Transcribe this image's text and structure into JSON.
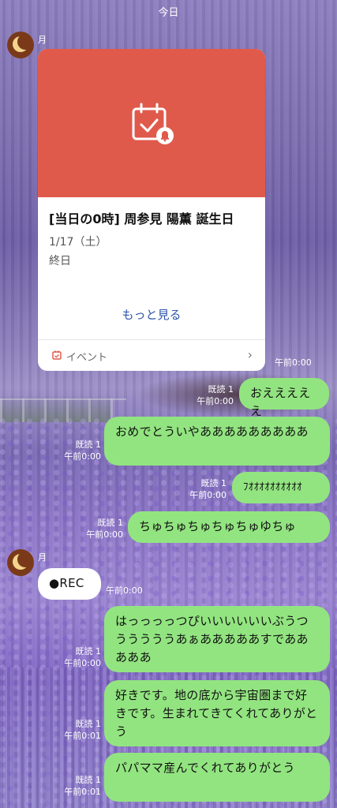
{
  "header": {
    "date_label": "今日"
  },
  "sender": {
    "name": "月"
  },
  "event_card": {
    "title": "[当日の0時] 周参見 陽薫 誕生日",
    "date": "1/17（土）",
    "all_day": "終日",
    "more_link": "もっと見る",
    "footer_label": "イベント",
    "colors": {
      "header": "#e05a4c",
      "link": "#2e56a8"
    }
  },
  "messages": [
    {
      "id": "m1",
      "text": "おえええええ",
      "read": "既読 1",
      "time": "午前0:00"
    },
    {
      "id": "m2",
      "text": "おめでとういやあああああああああ",
      "read": "既読 1",
      "time": "午前0:00"
    },
    {
      "id": "m3",
      "text": "ﾌｵｵｵｵｵｵｵｵｵｵ",
      "read": "既読 1",
      "time": "午前0:00"
    },
    {
      "id": "m4",
      "text": "ちゅちゅちゅちゅちゅゆちゅ",
      "read": "既読 1",
      "time": "午前0:00"
    },
    {
      "id": "m5",
      "text": "はっっっっつぴいいいいいいぶうつうううううあぁあああああすであああああ",
      "read": "既読 1",
      "time": "午前0:00"
    },
    {
      "id": "m6",
      "text": "好きです。地の底から宇宙圏まで好きです。生まれてきてくれてありがとう",
      "read": "既読 1",
      "time": "午前0:01"
    },
    {
      "id": "m7",
      "text": "パパママ産んでくれてありがとう",
      "read": "既読 1",
      "time": "午前0:01"
    }
  ],
  "incoming": {
    "card_time": "午前0:00",
    "rec_text": "●REC",
    "rec_time": "午前0:00"
  },
  "colors": {
    "outgoing_bubble": "#92e480",
    "incoming_bubble": "#ffffff"
  }
}
